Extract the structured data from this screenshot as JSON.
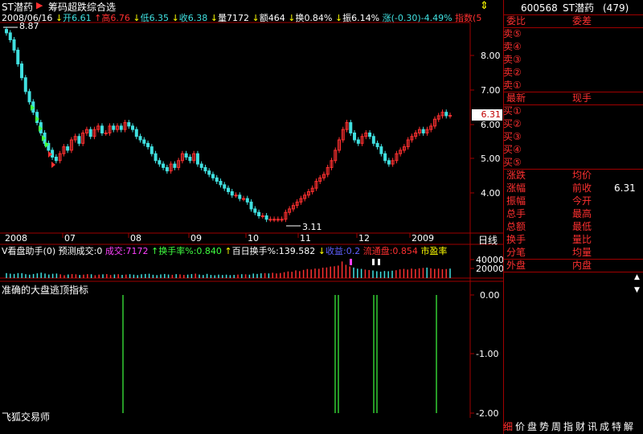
{
  "header": {
    "title": "ST潜药",
    "indicator_menu": "筹码超跌综合选",
    "date": "2008/06/16",
    "open_label": "开",
    "open": "6.61",
    "high_label": "高",
    "high": "6.76",
    "low_label": "低",
    "low": "6.35",
    "close_label": "收",
    "close": "6.38",
    "volume_label": "量",
    "volume": "7172",
    "amount_label": "额",
    "amount": "464",
    "turnover_label": "换",
    "turnover": "0.84%",
    "amplitude_label": "振",
    "amplitude": "6.14%",
    "change_label": "涨",
    "change": "(-0.30)-4.49%",
    "index_label": "指数(5",
    "expand_icon": "⇕"
  },
  "main_chart": {
    "yticks": [
      "8.00",
      "7.00",
      "6.00",
      "5.00",
      "4.00"
    ],
    "high_annotation": "8.87",
    "low_annotation": "3.11",
    "price_tag": "6.31",
    "xticks": [
      "2008",
      "07",
      "08",
      "09",
      "10",
      "11",
      "12",
      "2009"
    ],
    "period_label": "日线"
  },
  "volume_panel": {
    "indicator_name": "V看盘助手(0)",
    "forecast_label": "预测成交:0",
    "volume_label": "成交:7172",
    "turnover_label": "换手率%:0.840",
    "hundred_day_label": "百日换手%:139.582",
    "profit_label": "收益:0.2",
    "float_label": "流通盘:0.854",
    "pe_label": "市盈率",
    "yticks": [
      "40000",
      "20000"
    ]
  },
  "signal_panel": {
    "title": "准确的大盘逃顶指标",
    "yticks": [
      "0.00",
      "-1.00",
      "-2.00"
    ],
    "footer": "飞狐交易师"
  },
  "right_panel": {
    "code": "600568",
    "name": "ST潜药",
    "count": "(479)",
    "weibi": "委比",
    "weicha": "委差",
    "asks": [
      "卖⑤",
      "卖④",
      "卖③",
      "卖②",
      "卖①"
    ],
    "latest": "最新",
    "current_hand": "现手",
    "bids": [
      "买①",
      "买②",
      "买③",
      "买④",
      "买⑤"
    ],
    "stats_left": [
      "涨跌",
      "涨幅",
      "振幅",
      "总手",
      "总额",
      "换手",
      "分笔"
    ],
    "stats_right": [
      "均价",
      "前收",
      "今开",
      "最高",
      "最低",
      "量比",
      "均量"
    ],
    "prev_close_value": "6.31",
    "outer": "外盘",
    "inner": "内盘",
    "tabs": [
      "细",
      "价",
      "盘",
      "势",
      "周",
      "指",
      "财",
      "讯",
      "成",
      "特",
      "解"
    ]
  },
  "colors": {
    "up": "#ff3030",
    "down": "#40e0e0",
    "grid": "#a00000",
    "bg": "#000000",
    "signal": "#40ff40"
  },
  "chart_data": [
    {
      "type": "candlestick",
      "title": "ST潜药",
      "x": [
        "2008-06",
        "2008-06",
        "2008-06",
        "2008-06",
        "2008-06",
        "2008-06",
        "2008-06",
        "2008-06",
        "2008-06",
        "2008-06",
        "2008-06",
        "2008-06",
        "2008-06",
        "2008-06",
        "2008-06",
        "2008-07",
        "2008-07",
        "2008-07",
        "2008-07",
        "2008-07",
        "2008-07",
        "2008-07",
        "2008-07",
        "2008-07",
        "2008-07",
        "2008-07",
        "2008-07",
        "2008-07",
        "2008-07",
        "2008-07",
        "2008-07",
        "2008-08",
        "2008-08",
        "2008-08",
        "2008-08",
        "2008-08",
        "2008-08",
        "2008-08",
        "2008-08",
        "2008-08",
        "2008-08",
        "2008-08",
        "2008-08",
        "2008-08",
        "2008-08",
        "2008-08",
        "2008-09",
        "2008-09",
        "2008-09",
        "2008-09",
        "2008-09",
        "2008-09",
        "2008-09",
        "2008-09",
        "2008-09",
        "2008-09",
        "2008-09",
        "2008-09",
        "2008-09",
        "2008-09",
        "2008-10",
        "2008-10",
        "2008-10",
        "2008-10",
        "2008-10",
        "2008-10",
        "2008-10",
        "2008-10",
        "2008-10",
        "2008-10",
        "2008-10",
        "2008-10",
        "2008-11",
        "2008-11",
        "2008-11",
        "2008-11",
        "2008-11",
        "2008-11",
        "2008-11",
        "2008-11",
        "2008-11",
        "2008-11",
        "2008-11",
        "2008-11",
        "2008-11",
        "2008-11",
        "2008-12",
        "2008-12",
        "2008-12",
        "2008-12",
        "2008-12",
        "2008-12",
        "2008-12",
        "2008-12",
        "2008-12",
        "2008-12",
        "2008-12",
        "2008-12",
        "2008-12",
        "2008-12",
        "2009-01",
        "2009-01",
        "2009-01",
        "2009-01",
        "2009-01",
        "2009-01",
        "2009-01",
        "2009-01",
        "2009-01",
        "2009-01",
        "2009-01",
        "2009-01",
        "2009-02",
        "2009-02",
        "2009-02",
        "2009-02"
      ],
      "close": [
        8.7,
        8.5,
        8.2,
        7.8,
        7.4,
        7.0,
        6.7,
        6.4,
        6.1,
        5.8,
        5.5,
        5.3,
        5.1,
        5.0,
        5.2,
        5.4,
        5.3,
        5.6,
        5.7,
        5.5,
        5.8,
        5.9,
        5.7,
        5.9,
        6.0,
        5.8,
        5.8,
        6.0,
        5.9,
        6.0,
        5.9,
        6.1,
        6.0,
        5.9,
        5.7,
        5.6,
        5.5,
        5.4,
        5.2,
        5.0,
        4.9,
        4.8,
        4.7,
        4.9,
        4.8,
        5.0,
        5.2,
        5.1,
        5.0,
        5.2,
        4.9,
        4.8,
        4.7,
        4.6,
        4.5,
        4.4,
        4.3,
        4.2,
        4.1,
        4.0,
        4.0,
        3.9,
        3.9,
        3.8,
        3.6,
        3.5,
        3.4,
        3.4,
        3.3,
        3.3,
        3.3,
        3.3,
        3.3,
        3.5,
        3.6,
        3.7,
        3.8,
        3.9,
        4.0,
        4.1,
        4.2,
        4.4,
        4.5,
        4.6,
        4.8,
        5.0,
        5.3,
        5.6,
        5.9,
        6.1,
        5.8,
        5.6,
        5.5,
        5.7,
        5.8,
        5.7,
        5.5,
        5.4,
        5.2,
        5.0,
        4.9,
        5.0,
        5.2,
        5.3,
        5.4,
        5.6,
        5.7,
        5.8,
        5.9,
        5.8,
        5.9,
        6.0,
        6.2,
        6.3,
        6.4,
        6.3,
        6.31
      ],
      "ylim": [
        2.9,
        9.0
      ],
      "yticks": [
        8.0,
        7.0,
        6.0,
        5.0,
        4.0
      ],
      "high_marker": 8.87,
      "low_marker": 3.11,
      "last_price": 6.31
    },
    {
      "type": "bar",
      "title": "V看盘助手(0)",
      "ylim": [
        0,
        45000
      ],
      "yticks": [
        40000,
        20000
      ],
      "values": [
        9000,
        8000,
        7500,
        9000,
        8800,
        7000,
        6200,
        7400,
        8600,
        9800,
        8200,
        6500,
        7800,
        8200,
        6800,
        5200,
        6500,
        7200,
        6800,
        5600,
        6200,
        7100,
        6900,
        5200,
        6300,
        6800,
        7200,
        5600,
        6600,
        7000,
        5800,
        6400,
        7000,
        6200,
        5400,
        6900,
        7400,
        7800,
        6000,
        5400,
        6600,
        7400,
        6500,
        5900,
        7100,
        6700,
        5800,
        6300,
        7200,
        8000,
        6400,
        5600,
        7600,
        5800,
        5200,
        6300,
        5600,
        6200,
        5400,
        5800,
        6400,
        7000,
        6800,
        6200,
        8200,
        7500,
        8600,
        9000,
        8400,
        9600,
        8400,
        9200,
        10600,
        12000,
        11400,
        14000,
        12600,
        14800,
        16400,
        15600,
        17200,
        16800,
        18800,
        19200,
        20800,
        21400,
        22600,
        30000,
        24000,
        21000,
        19000,
        17000,
        16600,
        15400,
        14600,
        13800,
        12400,
        11600,
        12800,
        12400,
        13400,
        14200,
        15800,
        16600,
        15400,
        17200,
        16200,
        17600,
        18400,
        19000,
        17800,
        16600,
        17200,
        16000,
        16400,
        17200
      ]
    },
    {
      "type": "bar",
      "title": "准确的大盘逃顶指标",
      "ylim": [
        -2.0,
        0.0
      ],
      "yticks": [
        0.0,
        -1.0,
        -2.0
      ],
      "x": [
        "2008-07",
        "2008-12",
        "2008-12",
        "2008-12",
        "2008-12",
        "2009-01"
      ],
      "values": [
        -2.0,
        -2.0,
        -2.0,
        -2.0,
        -2.0,
        -2.0
      ]
    }
  ]
}
